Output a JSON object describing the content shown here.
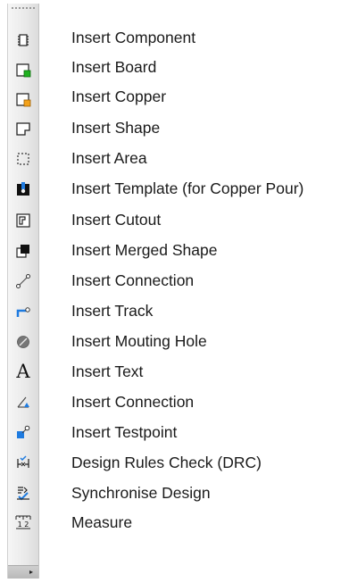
{
  "toolbar": {
    "items": [
      {
        "label": "Insert Component",
        "icon": "component-icon"
      },
      {
        "label": "Insert Board",
        "icon": "board-icon"
      },
      {
        "label": "Insert Copper",
        "icon": "copper-icon"
      },
      {
        "label": "Insert Shape",
        "icon": "shape-icon"
      },
      {
        "label": "Insert Area",
        "icon": "area-icon"
      },
      {
        "label": "Insert Template (for Copper Pour)",
        "icon": "template-icon"
      },
      {
        "label": "Insert Cutout",
        "icon": "cutout-icon"
      },
      {
        "label": "Insert Merged Shape",
        "icon": "merged-shape-icon"
      },
      {
        "label": "Insert Connection",
        "icon": "connection-icon"
      },
      {
        "label": "Insert Track",
        "icon": "track-icon"
      },
      {
        "label": "Insert Mouting Hole",
        "icon": "mounting-hole-icon"
      },
      {
        "label": "Insert Text",
        "icon": "text-icon"
      },
      {
        "label": "Insert Connection",
        "icon": "connection-arrow-icon"
      },
      {
        "label": "Insert Testpoint",
        "icon": "testpoint-icon"
      },
      {
        "label": "Design Rules Check (DRC)",
        "icon": "drc-icon"
      },
      {
        "label": "Synchronise Design",
        "icon": "synchronise-icon"
      },
      {
        "label": "Measure",
        "icon": "measure-icon"
      }
    ],
    "text_glyph": "A",
    "measure_glyph": "1 2",
    "overflow_glyph": "▸",
    "colors": {
      "board_green": "#1fb11f",
      "copper_orange": "#f3a21b",
      "track_blue": "#1e7be0",
      "icon_dark": "#222222"
    }
  }
}
